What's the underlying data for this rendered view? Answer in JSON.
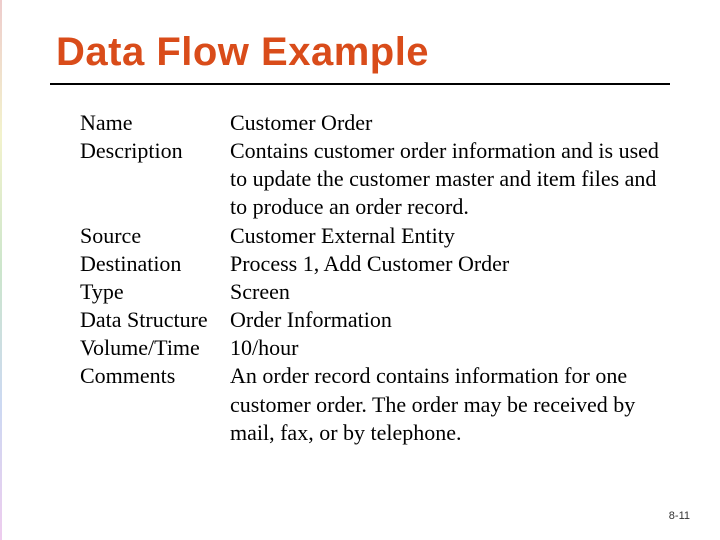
{
  "title": "Data Flow Example",
  "rows": [
    {
      "label": "Name",
      "value": "Customer Order"
    },
    {
      "label": "Description",
      "value": "Contains customer order information and is used to update the customer master and item files and to produce an order record."
    },
    {
      "label": "Source",
      "value": "Customer External Entity"
    },
    {
      "label": "Destination",
      "value": "Process 1, Add Customer Order"
    },
    {
      "label": "Type",
      "value": "Screen"
    },
    {
      "label": "Data Structure",
      "value": "Order Information"
    },
    {
      "label": "Volume/Time",
      "value": "10/hour"
    },
    {
      "label": "Comments",
      "value": "An order record contains information for one customer order.  The order may be received by mail, fax, or by telephone."
    }
  ],
  "footer": "8-11"
}
